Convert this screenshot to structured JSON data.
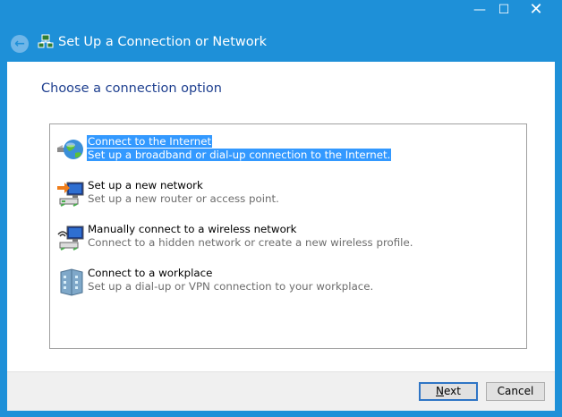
{
  "window": {
    "title": "Set Up a Connection or Network",
    "controls": {
      "minimize": "—",
      "maximize": "☐",
      "close": "✕"
    }
  },
  "heading": "Choose a connection option",
  "options": [
    {
      "title": "Connect to the Internet",
      "desc": "Set up a broadband or dial-up connection to the Internet.",
      "icon": "globe-icon",
      "selected": true
    },
    {
      "title": "Set up a new network",
      "desc": "Set up a new router or access point.",
      "icon": "router-icon",
      "selected": false
    },
    {
      "title": "Manually connect to a wireless network",
      "desc": "Connect to a hidden network or create a new wireless profile.",
      "icon": "wireless-icon",
      "selected": false
    },
    {
      "title": "Connect to a workplace",
      "desc": "Set up a dial-up or VPN connection to your workplace.",
      "icon": "workplace-icon",
      "selected": false
    }
  ],
  "buttons": {
    "next": "Next",
    "next_mnemonic": "N",
    "next_rest": "ext",
    "cancel": "Cancel"
  },
  "colors": {
    "accent": "#1e90d8",
    "selection": "#3399ff",
    "heading": "#1e3f8f"
  }
}
